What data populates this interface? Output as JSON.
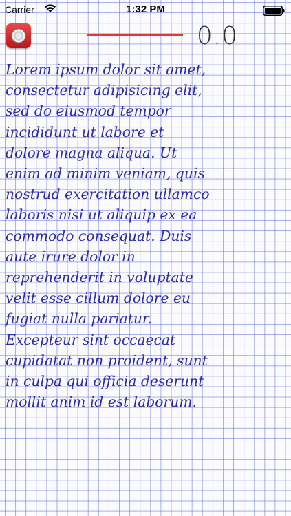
{
  "status_bar": {
    "carrier": "Carrier",
    "time": "1:32 PM",
    "wifi_icon": "wifi-icon",
    "battery_icon": "battery-icon"
  },
  "toolbar": {
    "record_icon": "record-icon",
    "level_meter": {
      "fill_fraction": 1.0,
      "fill_color": "#dd3b2c"
    },
    "level_value": "0.0"
  },
  "note": {
    "text_color": "#2c2bb0",
    "lines": [
      "Lorem ipsum dolor sit amet,",
      "consectetur adipisicing elit,",
      "sed do eiusmod tempor",
      "incididunt ut labore et",
      "dolore magna aliqua. Ut",
      "enim ad minim veniam, quis",
      "nostrud exercitation ullamco",
      "laboris nisi ut aliquip ex ea",
      "commodo consequat. Duis",
      "aute irure dolor in",
      "reprehenderit in voluptate",
      "velit esse cillum dolore eu",
      "fugiat nulla pariatur.",
      "Excepteur sint occaecat",
      "cupidatat non proident, sunt",
      "in culpa qui officia deserunt",
      "mollit anim id est laborum."
    ]
  },
  "colors": {
    "grid_line": "#5f6ed7",
    "paper": "#fbfbfe",
    "record_button": "#d22b2b"
  }
}
